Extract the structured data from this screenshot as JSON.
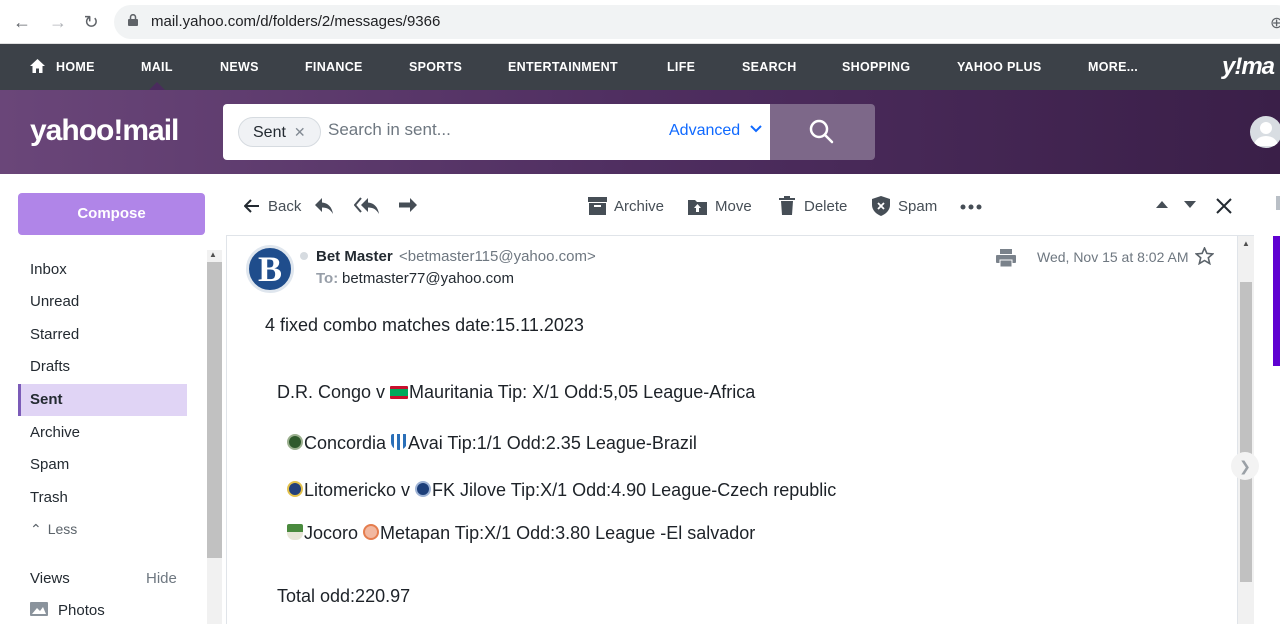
{
  "browser": {
    "url": "mail.yahoo.com/d/folders/2/messages/9366"
  },
  "topnav": {
    "items": [
      "HOME",
      "MAIL",
      "NEWS",
      "FINANCE",
      "SPORTS",
      "ENTERTAINMENT",
      "LIFE",
      "SEARCH",
      "SHOPPING",
      "YAHOO PLUS",
      "MORE..."
    ],
    "active": "MAIL",
    "brand_fragment": "y!ma"
  },
  "header": {
    "logo": "yahoo!mail",
    "search_pill": "Sent",
    "search_placeholder": "Search in sent...",
    "advanced_label": "Advanced"
  },
  "sidebar": {
    "compose_label": "Compose",
    "folders": [
      "Inbox",
      "Unread",
      "Starred",
      "Drafts",
      "Sent",
      "Archive",
      "Spam",
      "Trash"
    ],
    "active_folder": "Sent",
    "less_label": "Less",
    "views_label": "Views",
    "hide_label": "Hide",
    "photos_label": "Photos"
  },
  "toolbar": {
    "back_label": "Back",
    "archive_label": "Archive",
    "move_label": "Move",
    "delete_label": "Delete",
    "spam_label": "Spam"
  },
  "message": {
    "sender_initial": "B",
    "sender_name": "Bet Master",
    "sender_email": "<betmaster115@yahoo.com>",
    "to_label": "To:",
    "to_email": "betmaster77@yahoo.com",
    "date": "Wed, Nov 15 at 8:02 AM",
    "headline": "4 fixed combo matches date:15.11.2023",
    "match1_home": "D.R. Congo v ",
    "match1_rest": "Mauritania Tip: X/1 Odd:5,05 League-Africa",
    "match2_home": "Concordia ",
    "match2_rest": "Avai Tip:1/1 Odd:2.35 League-Brazil",
    "match3_home": "Litomericko v ",
    "match3_rest": "FK Jilove Tip:X/1 Odd:4.90 League-Czech republic",
    "match4_home": "Jocoro ",
    "match4_rest": "Metapan Tip:X/1 Odd:3.80 League -El salvador",
    "total": "Total odd:220.97"
  },
  "colors": {
    "nav_bg": "#3c4148",
    "header_purple": "#4f2e60",
    "compose": "#b085e8",
    "active_folder": "#e0d4f5",
    "link_blue": "#0f69ff"
  }
}
